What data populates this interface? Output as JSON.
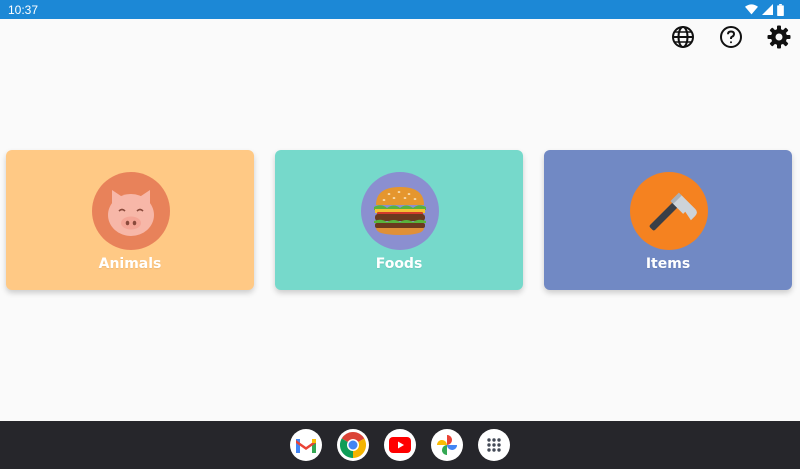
{
  "status_bar": {
    "time": "10:37",
    "icons": [
      "wifi-icon",
      "signal-icon",
      "battery-icon"
    ],
    "color": "#1c88d6"
  },
  "toolbar": {
    "icons": [
      "globe-icon",
      "help-icon",
      "settings-gear-icon"
    ]
  },
  "categories": [
    {
      "label": "Animals",
      "icon": "pig-icon",
      "card_color": "#ffc985",
      "circle_color": "#e8825a"
    },
    {
      "label": "Foods",
      "icon": "burger-icon",
      "card_color": "#76d9cb",
      "circle_color": "#8b8fd0"
    },
    {
      "label": "Items",
      "icon": "hammer-icon",
      "card_color": "#7189c4",
      "circle_color": "#f58220"
    }
  ],
  "taskbar": {
    "apps": [
      "gmail-icon",
      "chrome-icon",
      "youtube-icon",
      "photos-icon",
      "app-drawer-icon"
    ]
  }
}
